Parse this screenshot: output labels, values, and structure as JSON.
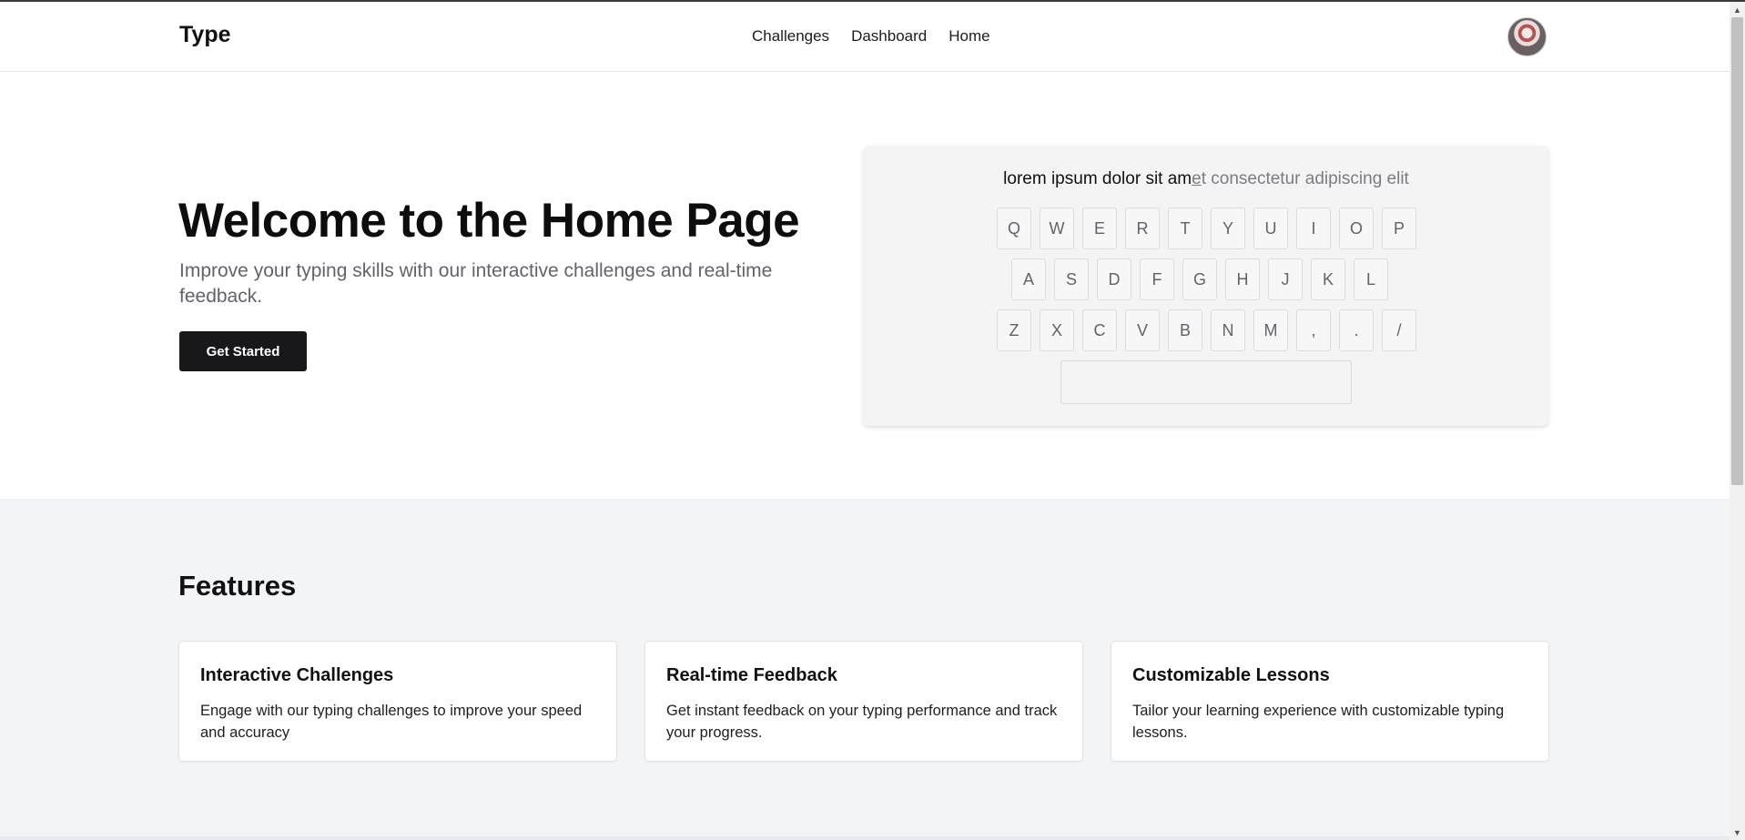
{
  "header": {
    "brand": "Type",
    "nav": [
      "Challenges",
      "Dashboard",
      "Home"
    ]
  },
  "hero": {
    "title": "Welcome to the Home Page",
    "subtitle": "Improve your typing skills with our interactive challenges and real-time feedback.",
    "cta_label": "Get Started"
  },
  "typing": {
    "typed": "lorem ipsum dolor sit am",
    "cursor": "e",
    "rest": "t consectetur adipiscing elit",
    "rows": [
      [
        "Q",
        "W",
        "E",
        "R",
        "T",
        "Y",
        "U",
        "I",
        "O",
        "P"
      ],
      [
        "A",
        "S",
        "D",
        "F",
        "G",
        "H",
        "J",
        "K",
        "L"
      ],
      [
        "Z",
        "X",
        "C",
        "V",
        "B",
        "N",
        "M",
        ",",
        ".",
        "/"
      ]
    ]
  },
  "features": {
    "title": "Features",
    "cards": [
      {
        "title": "Interactive Challenges",
        "text": "Engage with our typing challenges to improve your speed and accuracy"
      },
      {
        "title": "Real-time Feedback",
        "text": "Get instant feedback on your typing performance and track your progress."
      },
      {
        "title": "Customizable Lessons",
        "text": "Tailor your learning experience with customizable typing lessons."
      }
    ]
  },
  "scrollbar": {
    "up_icon": "▲",
    "down_icon": "▼"
  }
}
